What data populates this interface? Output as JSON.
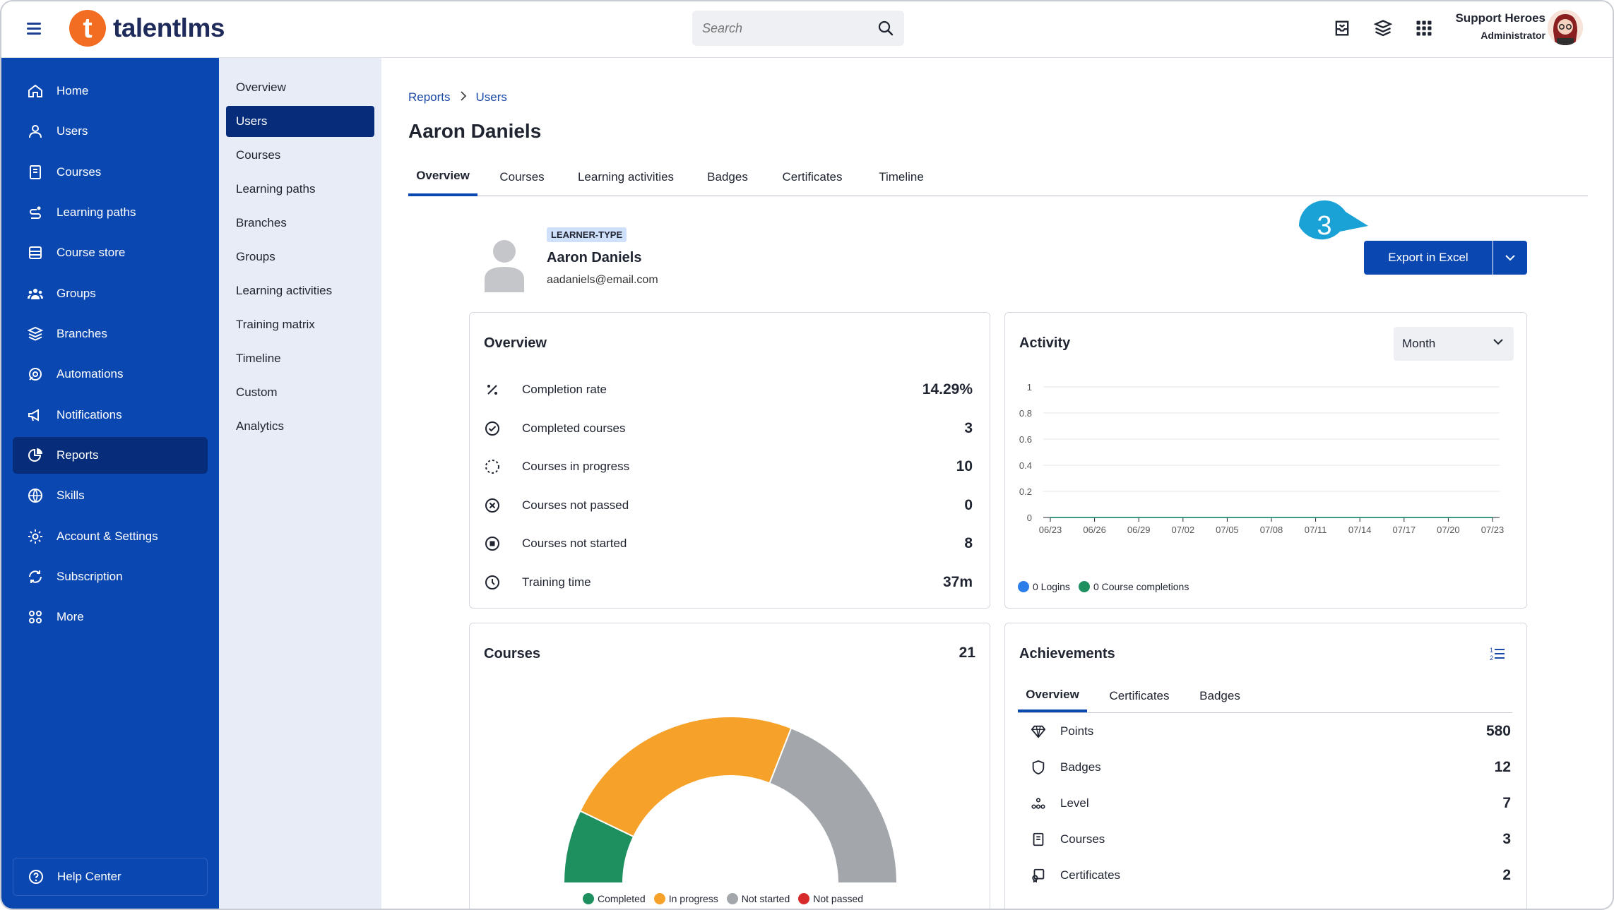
{
  "app": {
    "brand": "talentlms"
  },
  "search": {
    "placeholder": "Search"
  },
  "user": {
    "name": "Support Heroes",
    "role": "Administrator"
  },
  "sidebar": {
    "items": [
      {
        "label": "Home",
        "icon": "home-icon"
      },
      {
        "label": "Users",
        "icon": "user-icon"
      },
      {
        "label": "Courses",
        "icon": "book-icon"
      },
      {
        "label": "Learning paths",
        "icon": "path-icon"
      },
      {
        "label": "Course store",
        "icon": "store-icon"
      },
      {
        "label": "Groups",
        "icon": "groups-icon"
      },
      {
        "label": "Branches",
        "icon": "branches-icon"
      },
      {
        "label": "Automations",
        "icon": "automation-icon"
      },
      {
        "label": "Notifications",
        "icon": "megaphone-icon"
      },
      {
        "label": "Reports",
        "icon": "pie-chart-icon"
      },
      {
        "label": "Skills",
        "icon": "skills-icon"
      },
      {
        "label": "Account & Settings",
        "icon": "gear-icon"
      },
      {
        "label": "Subscription",
        "icon": "subscription-icon"
      },
      {
        "label": "More",
        "icon": "more-icon"
      }
    ],
    "active": "Reports",
    "help": "Help Center"
  },
  "subnav": {
    "items": [
      "Overview",
      "Users",
      "Courses",
      "Learning paths",
      "Branches",
      "Groups",
      "Learning activities",
      "Training matrix",
      "Timeline",
      "Custom",
      "Analytics"
    ],
    "active": "Users"
  },
  "breadcrumb": {
    "root": "Reports",
    "current": "Users"
  },
  "page_title": "Aaron Daniels",
  "tabs": [
    "Overview",
    "Courses",
    "Learning activities",
    "Badges",
    "Certificates",
    "Timeline"
  ],
  "profile": {
    "type": "LEARNER-TYPE",
    "name": "Aaron Daniels",
    "email": "aadaniels@email.com"
  },
  "export": {
    "label": "Export in Excel",
    "step": "3"
  },
  "overview": {
    "title": "Overview",
    "stats": [
      {
        "label": "Completion rate",
        "value": "14.29%",
        "icon": "percent-icon"
      },
      {
        "label": "Completed courses",
        "value": "3",
        "icon": "check-circle-icon"
      },
      {
        "label": "Courses in progress",
        "value": "10",
        "icon": "dashed-circle-icon"
      },
      {
        "label": "Courses not passed",
        "value": "0",
        "icon": "x-circle-icon"
      },
      {
        "label": "Courses not started",
        "value": "8",
        "icon": "stop-circle-icon"
      },
      {
        "label": "Training time",
        "value": "37m",
        "icon": "clock-icon"
      }
    ]
  },
  "activity": {
    "title": "Activity",
    "period": "Month",
    "legend": [
      {
        "label": "0 Logins",
        "color": "#2b7de9"
      },
      {
        "label": "0 Course completions",
        "color": "#1e9060"
      }
    ]
  },
  "courses": {
    "title": "Courses",
    "total": "21",
    "legend": [
      {
        "label": "Completed",
        "color": "#1e9060"
      },
      {
        "label": "In progress",
        "color": "#f6a12a"
      },
      {
        "label": "Not started",
        "color": "#a3a7ab"
      },
      {
        "label": "Not passed",
        "color": "#d72a2a"
      }
    ]
  },
  "achievements": {
    "title": "Achievements",
    "tabs": [
      "Overview",
      "Certificates",
      "Badges"
    ],
    "rows": [
      {
        "label": "Points",
        "value": "580",
        "icon": "diamond-icon"
      },
      {
        "label": "Badges",
        "value": "12",
        "icon": "shield-icon"
      },
      {
        "label": "Level",
        "value": "7",
        "icon": "level-icon"
      },
      {
        "label": "Courses",
        "value": "3",
        "icon": "book-icon"
      },
      {
        "label": "Certificates",
        "value": "2",
        "icon": "certificate-icon"
      }
    ]
  },
  "chart_data": [
    {
      "type": "line",
      "x": [
        "06/23",
        "06/26",
        "06/29",
        "07/02",
        "07/05",
        "07/08",
        "07/11",
        "07/14",
        "07/17",
        "07/20",
        "07/23"
      ],
      "yticks": [
        "0",
        "0.2",
        "0.4",
        "0.6",
        "0.8",
        "1"
      ],
      "ylim": [
        0,
        1
      ],
      "grid": true,
      "legend_placement": "bottom-left",
      "series": [
        {
          "name": "0 Logins",
          "values": [
            0,
            0,
            0,
            0,
            0,
            0,
            0,
            0,
            0,
            0,
            0
          ]
        },
        {
          "name": "0 Course completions",
          "values": [
            0,
            0,
            0,
            0,
            0,
            0,
            0,
            0,
            0,
            0,
            0
          ]
        }
      ]
    },
    {
      "type": "pie",
      "shape": "half-donut",
      "categories": [
        "Completed",
        "In progress",
        "Not started",
        "Not passed"
      ],
      "values": [
        3,
        10,
        8,
        0
      ],
      "colors": [
        "#1e9060",
        "#f6a12a",
        "#a3a7ab",
        "#d72a2a"
      ],
      "legend_placement": "bottom"
    }
  ]
}
